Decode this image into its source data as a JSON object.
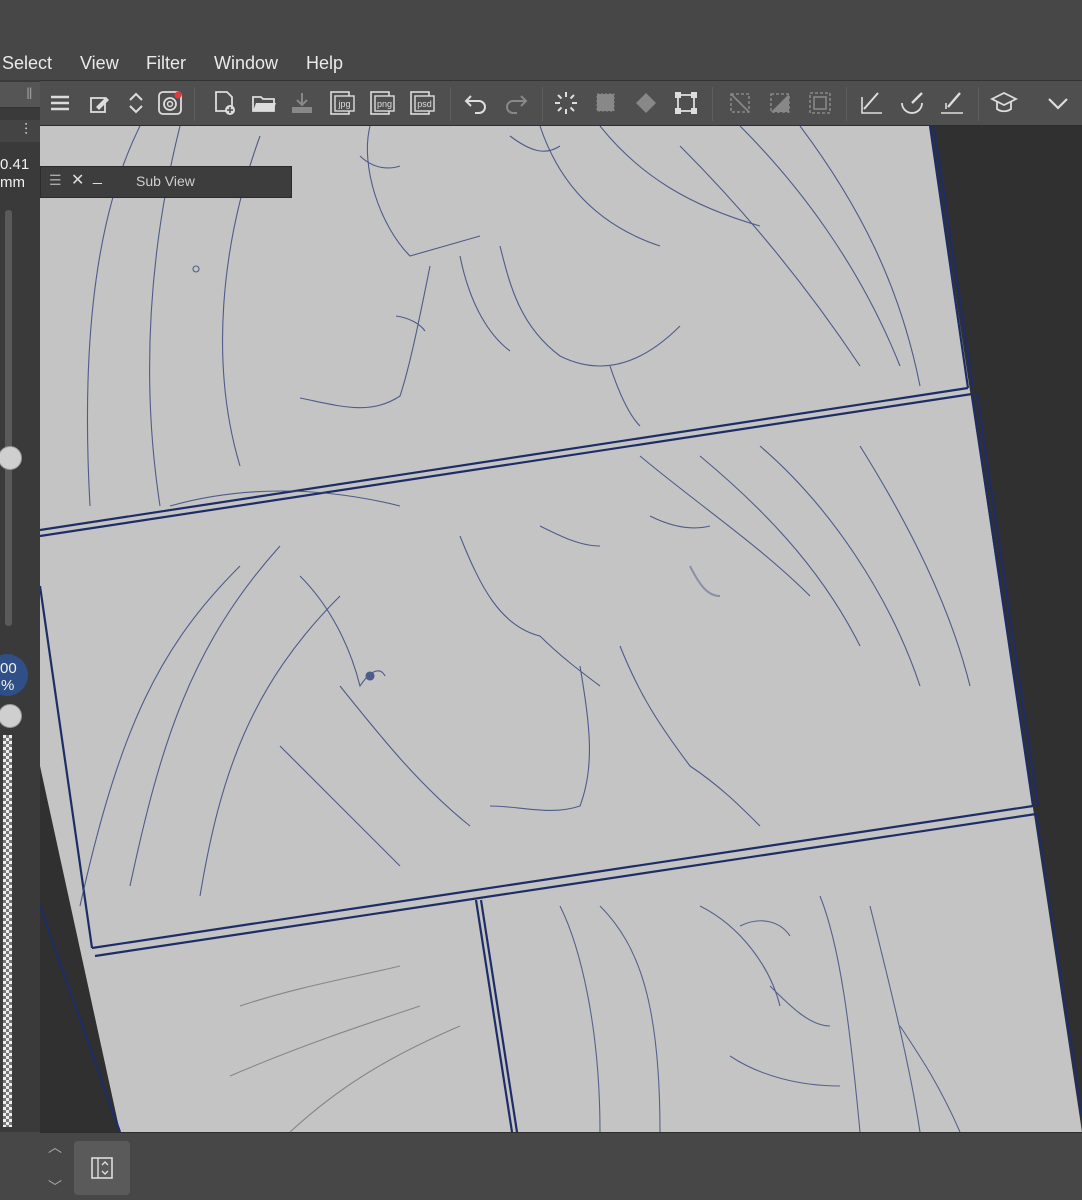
{
  "menu": {
    "select": "Select",
    "view": "View",
    "filter": "Filter",
    "window": "Window",
    "help": "Help"
  },
  "toolbar": {
    "icons": [
      "menu-icon",
      "eyedropper-icon",
      "up-down-arrows-icon",
      "clip-studio-icon",
      "new-canvas-icon",
      "open-folder-icon",
      "import-icon",
      "export-jpg-icon",
      "export-png-icon",
      "export-psd-icon",
      "undo-icon",
      "redo-icon",
      "loading-icon",
      "select-all-icon",
      "fill-icon",
      "transform-icon",
      "clear-selection-icon",
      "invert-selection-icon",
      "border-selection-icon",
      "ruler-icon",
      "brush-curve-icon",
      "pen-line-icon",
      "learn-icon",
      "chevron-down-icon"
    ],
    "jpg": "jpg",
    "png": "png",
    "psd": "psd"
  },
  "subview": {
    "title": "Sub View"
  },
  "side": {
    "brush_size_value": "0.41",
    "brush_size_unit": "mm",
    "opacity_value": "00",
    "opacity_unit": "%"
  },
  "colors": {
    "line_blue": "#2c3a70",
    "panel_border": "#1e2d66",
    "paper": "#c4c4c4",
    "badge_blue": "#2f4f86"
  }
}
